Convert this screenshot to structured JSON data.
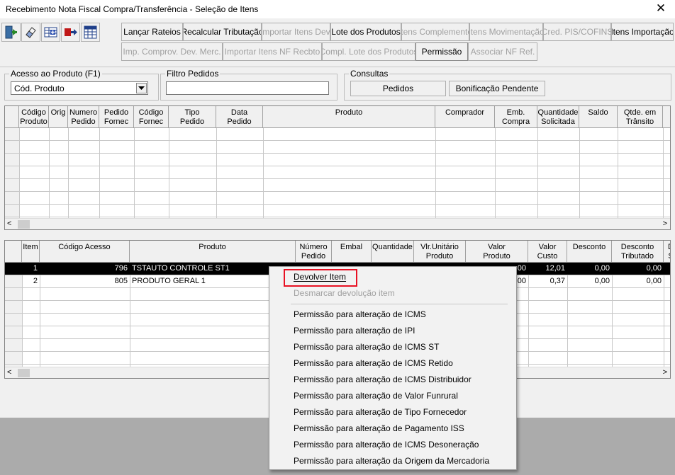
{
  "window": {
    "title": "Recebimento Nota Fiscal Compra/Transferência - Seleção de Itens",
    "close_glyph": "✕"
  },
  "toolbar": {
    "icons": [
      "exit-door-icon",
      "eraser-icon",
      "grid-add-icon",
      "move-right-icon",
      "grid-table-icon"
    ],
    "row1": [
      {
        "label": "Lançar Rateios",
        "enabled": true
      },
      {
        "label": "Recalcular Tributação",
        "enabled": true
      },
      {
        "label": "Importar Itens Dev.",
        "enabled": false
      },
      {
        "label": "Lote dos Produtos",
        "enabled": true
      },
      {
        "label": "Itens Complemento",
        "enabled": false
      },
      {
        "label": "Itens Movimentação",
        "enabled": false
      },
      {
        "label": "Cred. PIS/COFINS",
        "enabled": false
      },
      {
        "label": "Itens Importação",
        "enabled": true
      }
    ],
    "row2": [
      {
        "label": "Imp. Comprov. Dev. Merc.",
        "enabled": false
      },
      {
        "label": "Importar Itens NF Recbto",
        "enabled": false
      },
      {
        "label": "Compl. Lote dos Produtos",
        "enabled": false
      },
      {
        "label": "Permissão",
        "enabled": true
      },
      {
        "label": "Associar NF Ref.",
        "enabled": false
      }
    ]
  },
  "acesso": {
    "label": "Acesso ao Produto (F1)",
    "selected": "Cód. Produto"
  },
  "filtro": {
    "label": "Filtro Pedidos",
    "value": ""
  },
  "consultas": {
    "label": "Consultas",
    "pedidos": "Pedidos",
    "bonificacao": "Bonificação Pendente"
  },
  "grid1": {
    "columns": [
      [
        "Código",
        "Produto"
      ],
      [
        "Orig",
        ""
      ],
      [
        "Numero",
        "Pedido"
      ],
      [
        "Pedido",
        "Fornec"
      ],
      [
        "Código",
        "Fornec"
      ],
      [
        "Tipo",
        "Pedido"
      ],
      [
        "Data",
        "Pedido"
      ],
      [
        "Produto",
        ""
      ],
      [
        "Comprador",
        ""
      ],
      [
        "Emb.",
        "Compra"
      ],
      [
        "Quantidade",
        "Solicitada"
      ],
      [
        "Saldo",
        ""
      ],
      [
        "Qtde. em",
        "Trânsito"
      ]
    ],
    "scroll_left": "<",
    "scroll_right": ">"
  },
  "grid2": {
    "columns": [
      [
        "Item",
        ""
      ],
      [
        "Código Acesso",
        ""
      ],
      [
        "Produto",
        ""
      ],
      [
        "Número",
        "Pedido"
      ],
      [
        "Embal",
        ""
      ],
      [
        "Quantidade",
        ""
      ],
      [
        "Vlr.Unitário",
        "Produto"
      ],
      [
        "Valor",
        "Produto"
      ],
      [
        "Valor",
        "Custo"
      ],
      [
        "Desconto",
        ""
      ],
      [
        "Desconto",
        "Tributado"
      ],
      [
        "D",
        "S"
      ]
    ],
    "rows": [
      {
        "item": "1",
        "codigo": "796",
        "produto": "TSTAUTO CONTROLE ST1",
        "pedido": "",
        "embal": "",
        "quantidade": "",
        "vlr_unit": "",
        "valor_prod": "00",
        "valor_custo": "12,01",
        "desconto": "0,00",
        "desc_trib": "0,00",
        "selected": true
      },
      {
        "item": "2",
        "codigo": "805",
        "produto": "PRODUTO GERAL 1",
        "pedido": "",
        "embal": "",
        "quantidade": "",
        "vlr_unit": "",
        "valor_prod": "00",
        "valor_custo": "0,37",
        "desconto": "0,00",
        "desc_trib": "0,00",
        "selected": false
      }
    ],
    "scroll_left": "<",
    "scroll_right": ">"
  },
  "context_menu": {
    "items": [
      {
        "label": "Devolver Item",
        "enabled": true,
        "highlighted": true
      },
      {
        "label": "Desmarcar devolução item",
        "enabled": false
      },
      {
        "separator": true
      },
      {
        "label": "Permissão para alteração de ICMS",
        "enabled": true
      },
      {
        "label": "Permissão para alteração de IPI",
        "enabled": true
      },
      {
        "label": "Permissão para alteração de ICMS ST",
        "enabled": true
      },
      {
        "label": "Permissão para alteração de ICMS Retido",
        "enabled": true
      },
      {
        "label": "Permissão para alteração de ICMS Distribuidor",
        "enabled": true
      },
      {
        "label": "Permissão para alteração de Valor Funrural",
        "enabled": true
      },
      {
        "label": "Permissão para alteração de Tipo Fornecedor",
        "enabled": true
      },
      {
        "label": "Permissão para alteração de Pagamento ISS",
        "enabled": true
      },
      {
        "label": "Permissão para alteração de ICMS Desoneração",
        "enabled": true
      },
      {
        "label": "Permissão para alteração da Origem da Mercadoria",
        "enabled": true
      }
    ],
    "highlight_color": "#e81123"
  }
}
